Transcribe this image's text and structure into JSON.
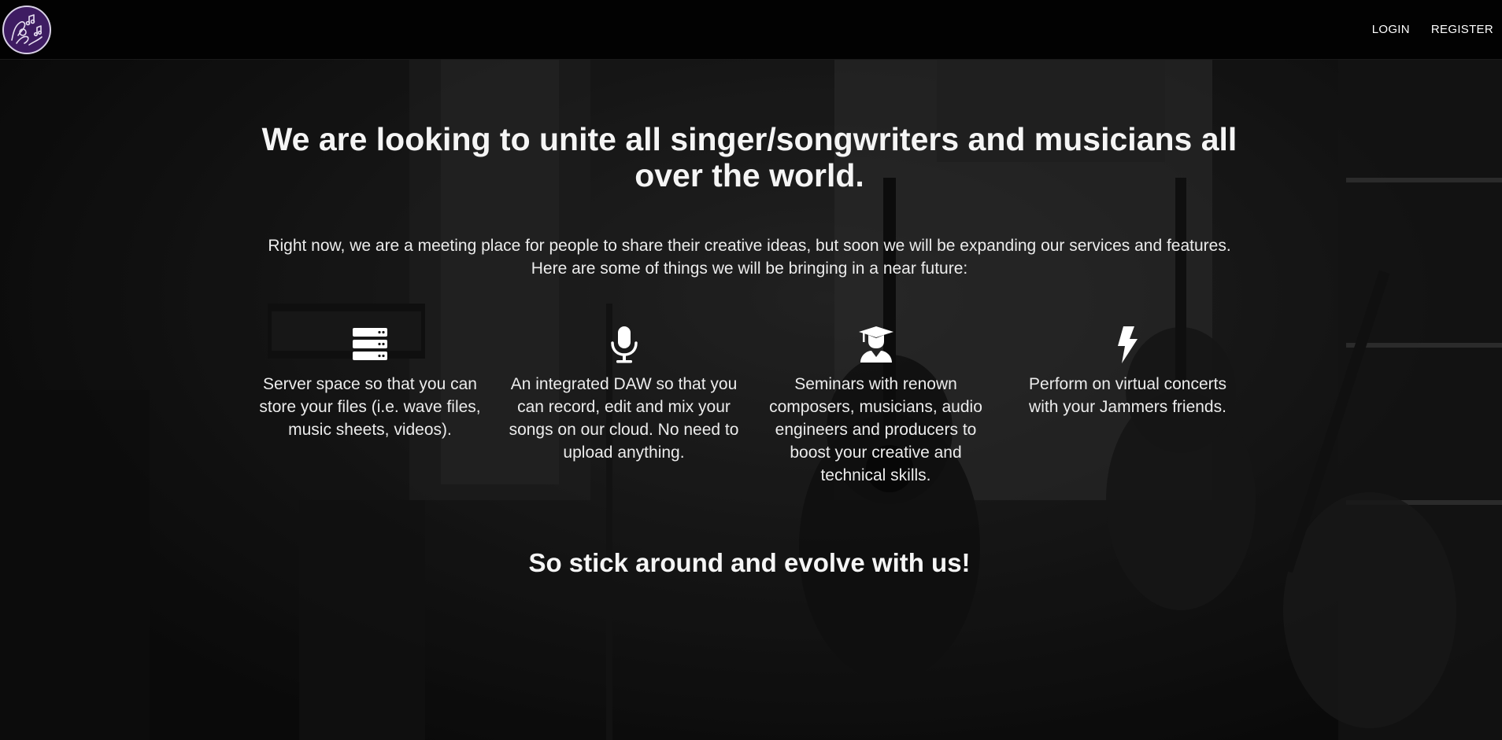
{
  "nav": {
    "logo_icon": "music-hands-logo-icon",
    "links": [
      {
        "label": "LOGIN"
      },
      {
        "label": "REGISTER"
      }
    ]
  },
  "hero": {
    "headline": "We are looking to unite all singer/songwriters and musicians all over the world.",
    "intro": "Right now, we are a meeting place for people to share their creative ideas, but soon we will be expanding our services and features. Here are some of things we will be bringing in a near future:",
    "features": [
      {
        "icon": "server-icon",
        "text": "Server space so that you can store your files (i.e. wave files, music sheets, videos)."
      },
      {
        "icon": "microphone-icon",
        "text": "An integrated DAW so that you can record, edit and mix your songs on our cloud. No need to upload anything."
      },
      {
        "icon": "graduate-icon",
        "text": "Seminars with renown composers, musicians, audio engineers and producers to boost your creative and technical skills."
      },
      {
        "icon": "bolt-icon",
        "text": "Perform on virtual concerts with your Jammers friends."
      }
    ],
    "closing": "So stick around and evolve with us!"
  },
  "colors": {
    "navbar": "#020202",
    "logo_bg": "#3e1c62",
    "text": "#f2f2f2"
  }
}
